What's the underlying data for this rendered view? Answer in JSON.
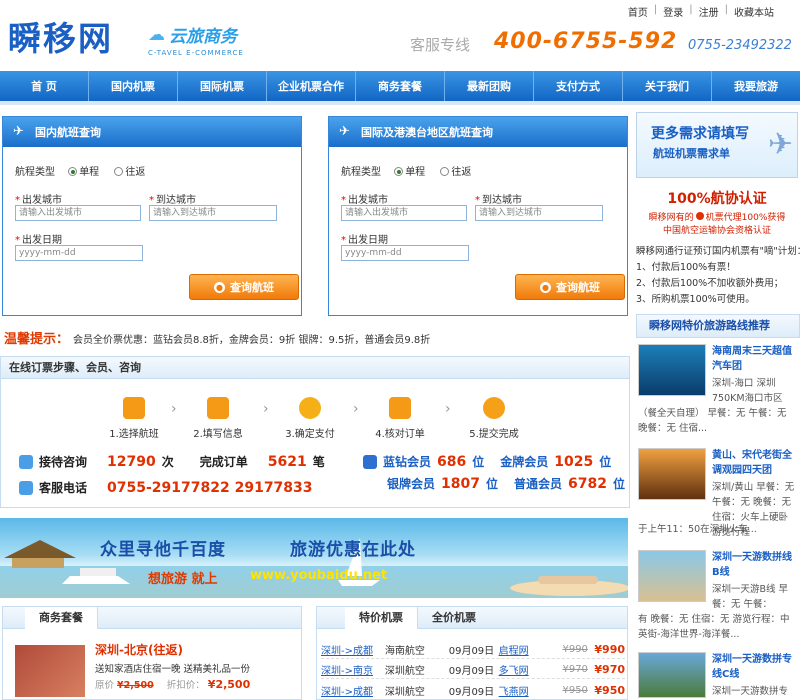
{
  "top_links": [
    "首页",
    "登录",
    "注册",
    "收藏本站"
  ],
  "logo": "瞬移网",
  "brand": {
    "text": "云旅商务",
    "sub": "C-TAVEL E-COMMERCE"
  },
  "hotline": {
    "label": "客服专线",
    "number": "400-6755-592",
    "local": "0755-23492322"
  },
  "nav": [
    "首 页",
    "国内机票",
    "国际机票",
    "企业机票合作",
    "商务套餐",
    "最新团购",
    "支付方式",
    "关于我们",
    "我要旅游"
  ],
  "domestic": {
    "title": "国内航班查询",
    "trip_label": "航程类型",
    "oneway": "单程",
    "roundtrip": "往返",
    "from_label": "出发城市",
    "to_label": "到达城市",
    "from_placeholder": "请输入出发城市",
    "to_placeholder": "请输入到达城市",
    "date_label": "出发日期",
    "date_placeholder": "yyyy-mm-dd",
    "search": "查询航班"
  },
  "intl": {
    "title": "国际及港澳台地区航班查询",
    "trip_label": "航程类型",
    "oneway": "单程",
    "roundtrip": "往返",
    "from_label": "出发城市",
    "to_label": "到达城市",
    "from_placeholder": "请输入出发城市",
    "to_placeholder": "请输入到达城市",
    "date_label": "出发日期",
    "date_placeholder": "yyyy-mm-dd",
    "search": "查询航班"
  },
  "tip": {
    "label": "温馨提示：",
    "text": "会员全价票优惠：蓝钻会员8.8折，金牌会员：9折 银牌：9.5折，普通会员9.8折"
  },
  "steps": {
    "title": "在线订票步骤、会员、咨询",
    "items": [
      "1.选择航班",
      "2.填写信息",
      "3.确定支付",
      "4.核对订单",
      "5.提交完成"
    ]
  },
  "stats": {
    "consult_label": "接待咨询",
    "consult_value": "12790",
    "consult_unit": "次",
    "orders_label": "完成订单",
    "orders_value": "5621",
    "orders_unit": "笔",
    "phone_label": "客服电话",
    "phone_value": "0755-29177822 29177833",
    "blue_label": "蓝钻会员",
    "blue_value": "686",
    "gold_label": "金牌会员",
    "gold_value": "1025",
    "silver_label": "银牌会员",
    "silver_value": "1807",
    "normal_label": "普通会员",
    "normal_value": "6782",
    "unit": "位"
  },
  "banner": {
    "t1": "众里寻他千百度",
    "t2": "旅游优惠在此处",
    "t3": "想旅游 就上",
    "t4": "www.youbaidu.net"
  },
  "package": {
    "tab": "商务套餐",
    "title": "深圳-北京(往返)",
    "desc": "送知家酒店住宿一晚 送精美礼品一份",
    "orig_label": "原价",
    "orig": "¥2,500",
    "disc_label": "折扣价：",
    "disc": "¥2,500"
  },
  "tickets": {
    "tab1": "特价机票",
    "tab2": "全价机票",
    "rows": [
      {
        "route": "深圳->成都",
        "airline": "海南航空",
        "date": "09月09日",
        "book": "启程网",
        "old": "¥990",
        "new": "¥990"
      },
      {
        "route": "深圳->南京",
        "airline": "深圳航空",
        "date": "09月09日",
        "book": "多飞网",
        "old": "¥970",
        "new": "¥970"
      },
      {
        "route": "深圳->成都",
        "airline": "深圳航空",
        "date": "09月09日",
        "book": "飞燕网",
        "old": "¥950",
        "new": "¥950"
      }
    ]
  },
  "right": {
    "promo": {
      "line1": "更多需求请填写",
      "line2": "航班机票需求单"
    },
    "cert": {
      "title": "100%航协认证",
      "line1": "瞬移网有的",
      "line2": "机票代理100%获得",
      "line3": "中国航空运输协会资格认证"
    },
    "guarantee": {
      "intro": "瞬移网通行证预订国内机票有\"嘀\"计划：",
      "items": [
        "1、付款后100%有票！",
        "2、付款后100%不加收额外费用；",
        "3、所购机票100%可使用。"
      ]
    },
    "routes_title": "瞬移网特价旅游路线推荐",
    "routes": [
      {
        "title": "海南周末三天超值汽车团",
        "desc": "深圳-海口 深圳750KM海口市区",
        "extra": "（餐全天自理） 早餐：无 午餐：无 晚餐：无 住宿..."
      },
      {
        "title": "黄山、宋代老街全调观园四天团",
        "desc": "深圳/黄山 早餐：无 午餐：无 晚餐：无 住宿：火车上硬卧 游览行程",
        "extra": "于上午11：50在深圳火车..."
      },
      {
        "title": "深圳一天游数拼线B线",
        "desc": "深圳一天游B线 早餐：无 午餐：",
        "extra": "有 晚餐：无 住宿：无 游览行程：中英街-海洋世界-海洋餐..."
      },
      {
        "title": "深圳一天游数拼专线C线",
        "desc": "深圳一天游数拼专"
      }
    ]
  }
}
